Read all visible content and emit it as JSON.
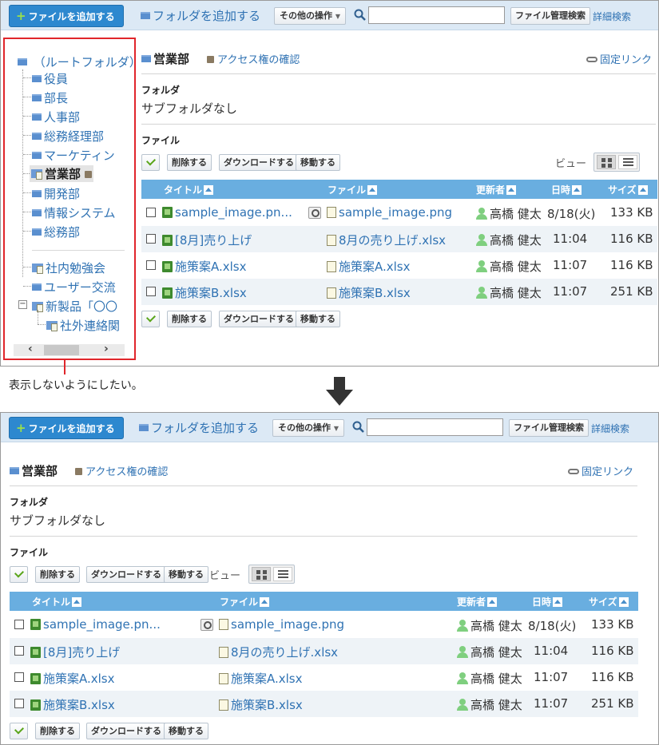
{
  "toolbar": {
    "add_file": "ファイルを追加する",
    "add_folder": "フォルダを追加する",
    "other_ops": "その他の操作",
    "search_value": "",
    "file_search": "ファイル管理検索",
    "detail_search": "詳細検索"
  },
  "tree": {
    "root": "（ルートフォルダ）",
    "items": [
      "役員",
      "部長",
      "人事部",
      "総務経理部",
      "マーケティン",
      "営業部",
      "開発部",
      "情報システム",
      "総務部"
    ],
    "special_items": [
      "社内勉強会",
      "ユーザー交流",
      "新製品「〇〇",
      "社外連絡関"
    ],
    "scroll_left": "‹",
    "scroll_right": "›"
  },
  "folder": {
    "name": "営業部",
    "access": "アクセス権の確認",
    "permalink": "固定リンク",
    "subfolder_label": "フォルダ",
    "subfolder_text": "サブフォルダなし",
    "file_label": "ファイル"
  },
  "actions": {
    "delete": "削除する",
    "download": "ダウンロードする",
    "move": "移動する",
    "view_label": "ビュー"
  },
  "table": {
    "headers": [
      "タイトル",
      "ファイル",
      "更新者",
      "日時",
      "サイズ"
    ],
    "rows": [
      {
        "title": "sample_image.pn...",
        "file": "sample_image.png",
        "updater": "高橋 健太",
        "date": "8/18(火)",
        "size": "133 KB"
      },
      {
        "title": "[8月]売り上げ",
        "file": "8月の売り上げ.xlsx",
        "updater": "高橋 健太",
        "date": "11:04",
        "size": "116 KB"
      },
      {
        "title": "施策案A.xlsx",
        "file": "施策案A.xlsx",
        "updater": "高橋 健太",
        "date": "11:07",
        "size": "116 KB"
      },
      {
        "title": "施策案B.xlsx",
        "file": "施策案B.xlsx",
        "updater": "高橋 健太",
        "date": "11:07",
        "size": "251 KB"
      }
    ]
  },
  "annotation": {
    "text": "表示しないようにしたい。"
  },
  "colors": {
    "accent": "#2d88cf",
    "toolbar_bg": "#dce9f5",
    "table_header": "#69aee0",
    "link": "#2f72b3",
    "highlight_border": "#e0262b"
  }
}
